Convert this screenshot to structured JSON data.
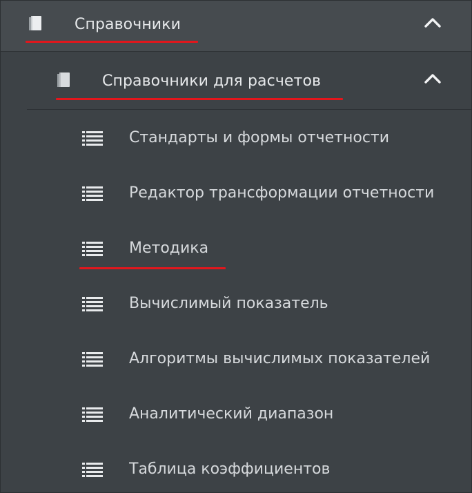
{
  "menu": {
    "section": {
      "label": "Справочники",
      "icon": "book-icon",
      "expanded": true
    },
    "subsection": {
      "label": "Справочники для расчетов",
      "icon": "book-icon",
      "expanded": true
    },
    "items": [
      {
        "label": "Стандарты и формы отчетности",
        "icon": "list-icon"
      },
      {
        "label": "Редактор трансформации отчетности",
        "icon": "list-icon"
      },
      {
        "label": "Методика",
        "icon": "list-icon"
      },
      {
        "label": "Вычислимый показатель",
        "icon": "list-icon"
      },
      {
        "label": "Алгоритмы вычислимых показателей",
        "icon": "list-icon"
      },
      {
        "label": "Аналитический диапазон",
        "icon": "list-icon"
      },
      {
        "label": "Таблица коэффициентов",
        "icon": "list-icon"
      }
    ]
  },
  "colors": {
    "background": "#3d4246",
    "text": "#e6e8ea",
    "highlight_underline": "#e3161c"
  }
}
